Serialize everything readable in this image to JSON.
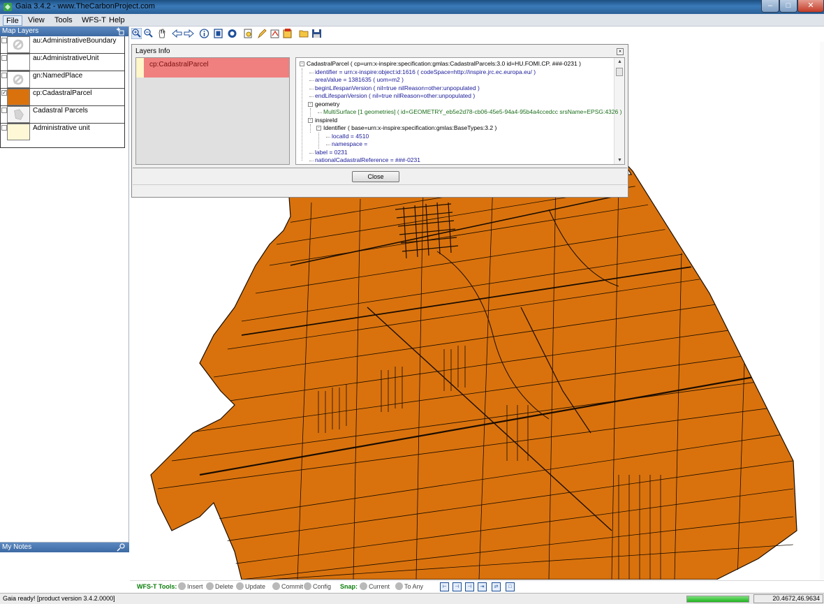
{
  "window": {
    "title": "Gaia 3.4.2 - www.TheCarbonProject.com",
    "minimize_icon": "minimize-icon",
    "maximize_icon": "maximize-icon",
    "close_icon": "close-icon"
  },
  "menu": [
    {
      "label": "File",
      "active": true
    },
    {
      "label": "View"
    },
    {
      "label": "Tools"
    },
    {
      "label": "WFS-T"
    },
    {
      "label": "Help"
    }
  ],
  "map_layers": {
    "header": "Map Layers",
    "items": [
      {
        "label": "au:AdministrativeBoundary",
        "checked": false,
        "swatch": "no-symbol"
      },
      {
        "label": "au:AdministrativeUnit",
        "checked": false,
        "swatch": "white"
      },
      {
        "label": "gn:NamedPlace",
        "checked": false,
        "swatch": "no-symbol"
      },
      {
        "label": "cp:CadastralParcel",
        "checked": true,
        "swatch": "#d9720d"
      },
      {
        "label": "Cadastral Parcels",
        "checked": false,
        "swatch": "map-thumbnail"
      },
      {
        "label": "Administrative unit",
        "checked": false,
        "swatch": "#fff8d6"
      }
    ]
  },
  "notes": {
    "header": "My Notes"
  },
  "dialog": {
    "title": "Layers Info",
    "list_item": "cp:CadastralParcel",
    "close_label": "Close",
    "tree": [
      {
        "text": "CadastralParcel ( cp=urn:x-inspire:specification:gmlas:CadastralParcels:3.0 id=HU.FOMI.CP. ###-0231 )",
        "kind": "root",
        "depth": 0,
        "expander": "-"
      },
      {
        "text": "identifier = urn:x-inspire:object:id:1616 ( codeSpace=http://inspire.jrc.ec.europa.eu/ )",
        "kind": "leaf",
        "depth": 1
      },
      {
        "text": "areaValue = 1381635 ( uom=m2 )",
        "kind": "leaf",
        "depth": 1
      },
      {
        "text": "beginLifespanVersion ( nil=true nilReason=other:unpopulated )",
        "kind": "leaf",
        "depth": 1
      },
      {
        "text": "endLifespanVersion ( nil=true nilReason=other:unpopulated )",
        "kind": "leaf",
        "depth": 1
      },
      {
        "text": "geometry",
        "kind": "group",
        "depth": 1,
        "expander": "-"
      },
      {
        "text": "MultiSurface [1 geometries]   ( id=GEOMETRY_eb5e2d78-cb06-45e5-94a4-95b4a4ccedcc srsName=EPSG:4326 )",
        "kind": "geom",
        "depth": 2
      },
      {
        "text": "inspireId",
        "kind": "group",
        "depth": 1,
        "expander": "-"
      },
      {
        "text": "Identifier ( base=urn:x-inspire:specification:gmlas:BaseTypes:3.2 )",
        "kind": "group",
        "depth": 2,
        "expander": "-"
      },
      {
        "text": "localId = 4510",
        "kind": "leaf",
        "depth": 3
      },
      {
        "text": "namespace =",
        "kind": "leaf",
        "depth": 3
      },
      {
        "text": "label = 0231",
        "kind": "leaf",
        "depth": 1
      },
      {
        "text": "nationalCadastralReference = ###-0231",
        "kind": "leaf",
        "depth": 1
      }
    ]
  },
  "toolbar_icons": [
    "zoom-in-icon",
    "zoom-out-icon",
    "pan-icon",
    "back-icon",
    "forward-icon",
    "info-icon",
    "full-extent-icon",
    "refresh-icon",
    "search-icon",
    "edit-icon",
    "bookmark-icon",
    "layers-icon",
    "open-folder-icon",
    "save-icon"
  ],
  "wfs": {
    "label": "WFS-T Tools:",
    "insert": "Insert",
    "delete": "Delete",
    "update": "Update",
    "commit": "Commit",
    "config": "Config",
    "snap": "Snap:",
    "current": "Current",
    "to_any": "To Any"
  },
  "status": {
    "message": "Gaia ready! [product version 3.4.2.0000]",
    "progress": 1.0,
    "coords": "20.4672,46.9634"
  },
  "colors": {
    "parcel_fill": "#d9720d",
    "parcel_stroke": "#1a0c00",
    "highlight": "#f08080"
  }
}
